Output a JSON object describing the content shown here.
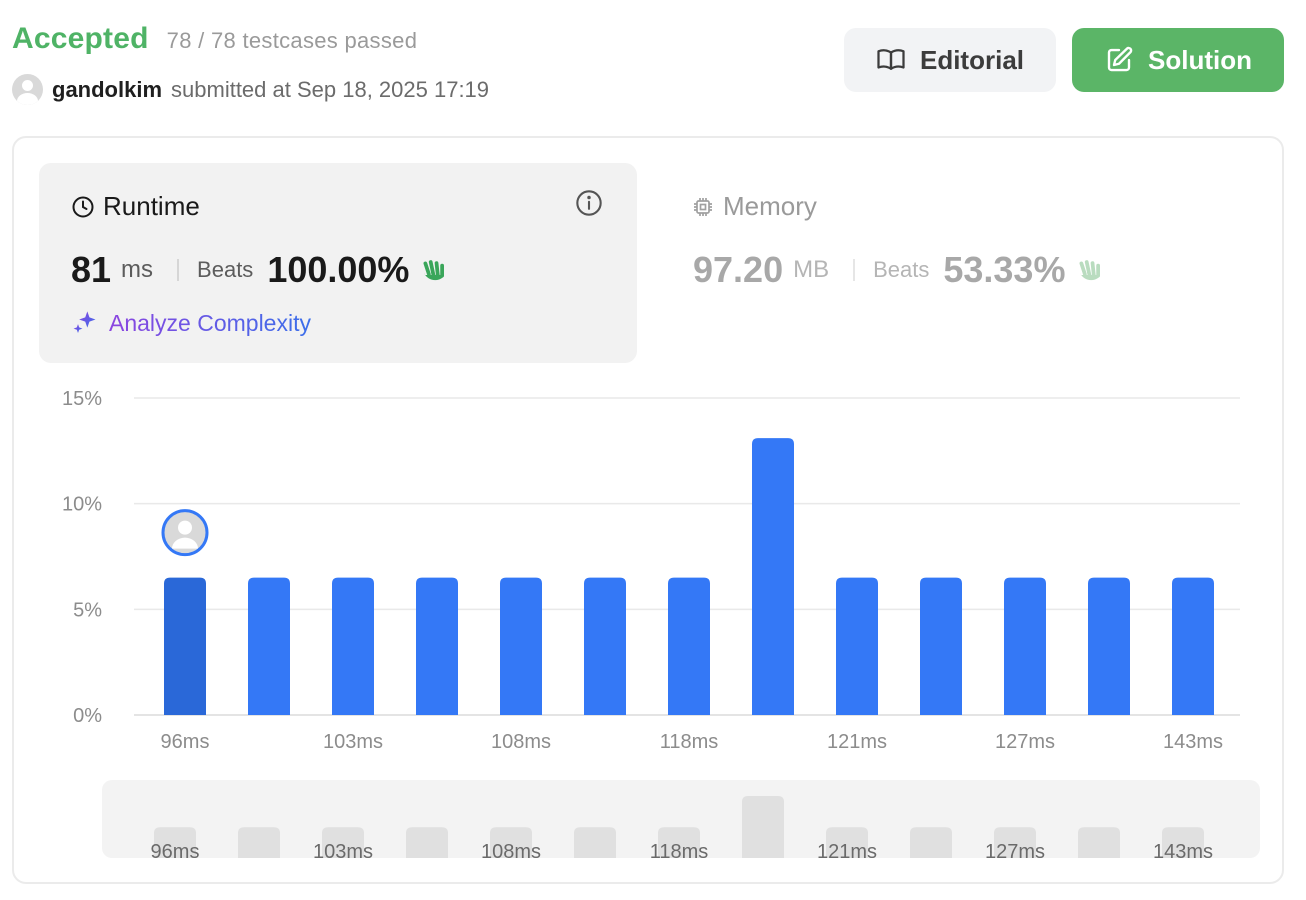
{
  "header": {
    "status": "Accepted",
    "testcases": "78 / 78 testcases passed",
    "username": "gandolkim",
    "submitted_text": "submitted at Sep 18, 2025 17:19",
    "editorial_label": "Editorial",
    "solution_label": "Solution"
  },
  "runtime": {
    "title": "Runtime",
    "value": "81",
    "unit": "ms",
    "beats_label": "Beats",
    "beats_value": "100.00%",
    "analyze_label": "Analyze Complexity"
  },
  "memory": {
    "title": "Memory",
    "value": "97.20",
    "unit": "MB",
    "beats_label": "Beats",
    "beats_value": "53.33%"
  },
  "colors": {
    "accepted": "#4fb366",
    "bar": "#3478f6",
    "bar_highlight": "#2a68d8",
    "solution_button": "#5bb567"
  },
  "chart_data": {
    "type": "bar",
    "ylim": [
      0,
      15
    ],
    "yticks": [
      "0%",
      "5%",
      "10%",
      "15%"
    ],
    "ytick_values": [
      0,
      5,
      10,
      15
    ],
    "values": [
      6.5,
      6.5,
      6.5,
      6.5,
      6.5,
      6.5,
      6.5,
      13.1,
      6.5,
      6.5,
      6.5,
      6.5,
      6.5
    ],
    "x_tick_labels": [
      "96ms",
      "",
      "103ms",
      "",
      "108ms",
      "",
      "118ms",
      "",
      "121ms",
      "",
      "127ms",
      "",
      "143ms"
    ],
    "highlight_index": 0,
    "grid": true
  }
}
